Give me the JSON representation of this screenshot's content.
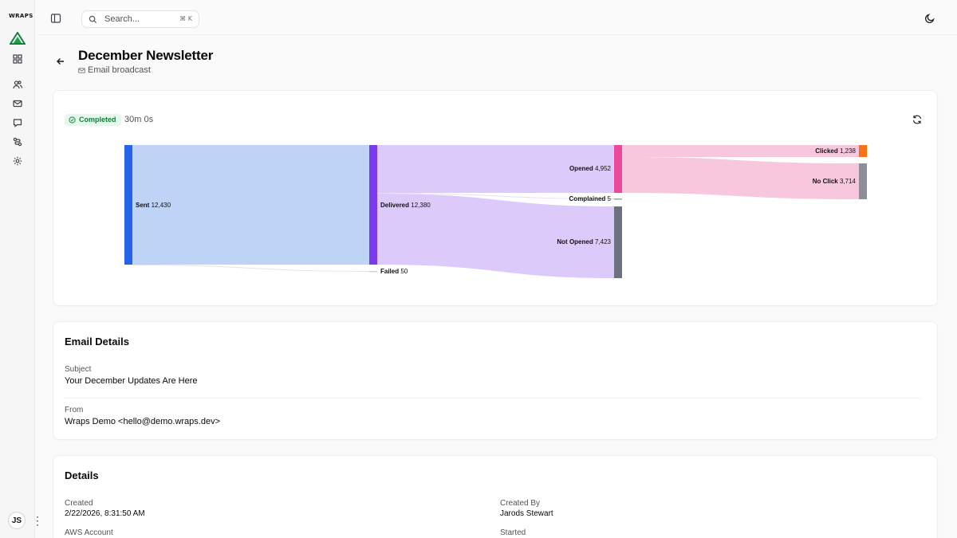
{
  "sidebar": {
    "logo": "WRAPS",
    "icons": [
      "dashboard-icon",
      "contacts-icon",
      "mail-icon",
      "message-icon",
      "workflow-icon",
      "settings-icon"
    ],
    "avatar_initials": "JS"
  },
  "topbar": {
    "search_placeholder": "Search...",
    "search_shortcut": "⌘ K"
  },
  "header": {
    "title": "December Newsletter",
    "subtitle": "Email broadcast"
  },
  "status": {
    "label": "Completed",
    "duration": "30m 0s",
    "color": "#15803d"
  },
  "flow": {
    "nodes": [
      {
        "id": "sent",
        "name": "Sent",
        "value": "12,430",
        "color": "#2563eb"
      },
      {
        "id": "delivered",
        "name": "Delivered",
        "value": "12,380",
        "color": "#7c3aed"
      },
      {
        "id": "failed",
        "name": "Failed",
        "value": "50",
        "color": "#d4d4d8"
      },
      {
        "id": "opened",
        "name": "Opened",
        "value": "4,952",
        "color": "#ec4899"
      },
      {
        "id": "complained",
        "name": "Complained",
        "value": "5",
        "color": "#a1a1aa"
      },
      {
        "id": "not_opened",
        "name": "Not Opened",
        "value": "7,423",
        "color": "#6b7280"
      },
      {
        "id": "clicked",
        "name": "Clicked",
        "value": "1,238",
        "color": "#f97316"
      },
      {
        "id": "no_click",
        "name": "No Click",
        "value": "3,714",
        "color": "#8b8f99"
      }
    ],
    "link_colors": {
      "sent": "#bfd3f7",
      "delivered": "#dccbfa",
      "opened": "#f7c7dd"
    }
  },
  "email_details": {
    "title": "Email Details",
    "subject_label": "Subject",
    "subject": "Your December Updates Are Here",
    "from_label": "From",
    "from": "Wraps Demo <hello@demo.wraps.dev>"
  },
  "details": {
    "title": "Details",
    "created_label": "Created",
    "created": "2/22/2026, 8:31:50 AM",
    "created_by_label": "Created By",
    "created_by": "Jarods Stewart",
    "aws_account_label": "AWS Account",
    "started_label": "Started"
  }
}
